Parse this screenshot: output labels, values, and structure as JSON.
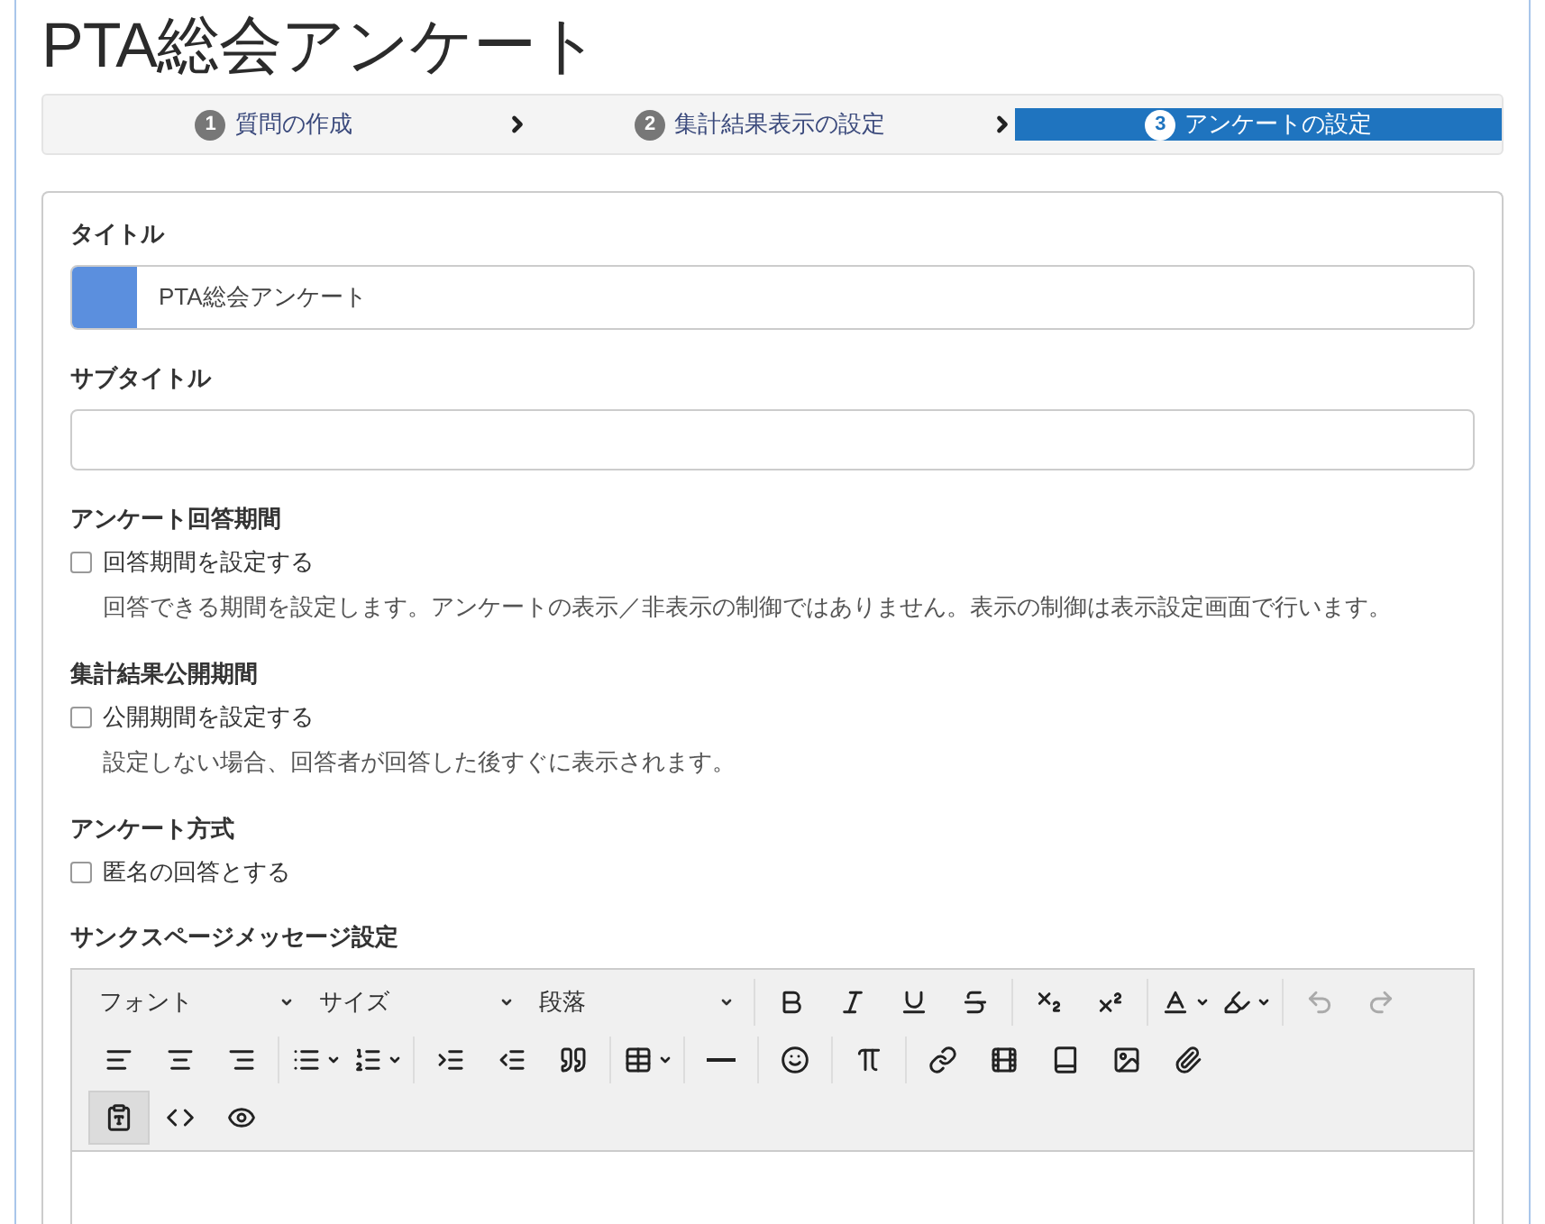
{
  "page_title": "PTA総会アンケート",
  "steps": [
    {
      "number": "1",
      "label": "質問の作成",
      "selected": false
    },
    {
      "number": "2",
      "label": "集計結果表示の設定",
      "selected": false
    },
    {
      "number": "3",
      "label": "アンケートの設定",
      "selected": true
    }
  ],
  "title_field": {
    "label": "タイトル",
    "value": "PTA総会アンケート",
    "color": "#5b8fde"
  },
  "subtitle_field": {
    "label": "サブタイトル"
  },
  "option_sections": [
    {
      "heading": "アンケート回答期間",
      "checkbox": {
        "label": "回答期間を設定する",
        "checked": false
      },
      "help": "回答できる期間を設定します。アンケートの表示／非表示の制御ではありません。表示の制御は表示設定画面で行います。"
    },
    {
      "heading": "集計結果公開期間",
      "checkbox": {
        "label": "公開期間を設定する",
        "checked": false
      },
      "help": "設定しない場合、回答者が回答した後すぐに表示されます。"
    },
    {
      "heading": "アンケート方式",
      "checkbox": {
        "label": "匿名の回答とする",
        "checked": false
      }
    }
  ],
  "thanks_editor": {
    "label": "サンクスページメッセージ設定",
    "toolbar_rows": [
      [
        [
          {
            "kind": "select",
            "label": "フォント"
          },
          {
            "kind": "select",
            "label": "サイズ"
          },
          {
            "kind": "select",
            "label": "段落"
          }
        ],
        [
          {
            "kind": "bold"
          },
          {
            "kind": "italic"
          },
          {
            "kind": "underline"
          },
          {
            "kind": "strike"
          }
        ],
        [
          {
            "kind": "subscript"
          },
          {
            "kind": "superscript"
          }
        ],
        [
          {
            "kind": "text-color"
          },
          {
            "kind": "bg-color"
          }
        ],
        [
          {
            "kind": "undo",
            "disabled": true
          },
          {
            "kind": "redo",
            "disabled": true
          }
        ]
      ],
      [
        [
          {
            "kind": "align-left"
          },
          {
            "kind": "align-center"
          },
          {
            "kind": "align-right"
          }
        ],
        [
          {
            "kind": "bullet-list"
          },
          {
            "kind": "number-list"
          }
        ],
        [
          {
            "kind": "indent"
          },
          {
            "kind": "outdent"
          },
          {
            "kind": "quote"
          }
        ],
        [
          {
            "kind": "table"
          }
        ],
        [
          {
            "kind": "rule"
          }
        ],
        [
          {
            "kind": "emoji"
          }
        ],
        [
          {
            "kind": "math"
          }
        ],
        [
          {
            "kind": "link"
          },
          {
            "kind": "video"
          },
          {
            "kind": "book"
          },
          {
            "kind": "image"
          },
          {
            "kind": "attach"
          }
        ]
      ],
      [
        [
          {
            "kind": "paste-text",
            "active": true
          },
          {
            "kind": "code",
            "active": false
          },
          {
            "kind": "preview",
            "active": false
          }
        ]
      ]
    ]
  }
}
